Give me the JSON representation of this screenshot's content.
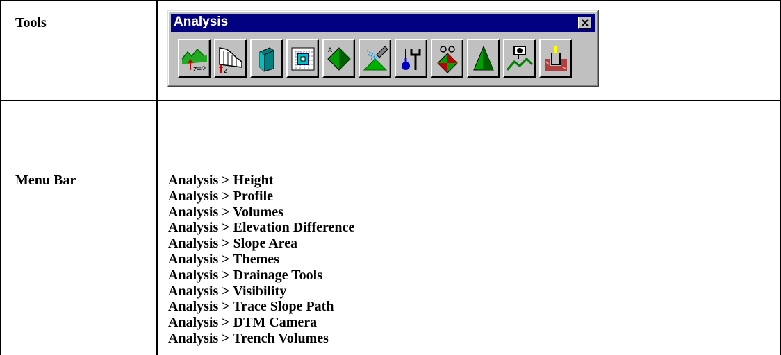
{
  "rows": {
    "tools_label": "Tools",
    "menu_label": "Menu Bar"
  },
  "toolbar": {
    "title": "Analysis",
    "tools": [
      {
        "icon": "height-icon",
        "label": "Height"
      },
      {
        "icon": "profile-icon",
        "label": "Profile"
      },
      {
        "icon": "volumes-icon",
        "label": "Volumes"
      },
      {
        "icon": "elevation-difference-icon",
        "label": "Elevation Difference"
      },
      {
        "icon": "slope-area-icon",
        "label": "Slope Area"
      },
      {
        "icon": "themes-icon",
        "label": "Themes"
      },
      {
        "icon": "drainage-tools-icon",
        "label": "Drainage Tools"
      },
      {
        "icon": "visibility-icon",
        "label": "Visibility"
      },
      {
        "icon": "trace-slope-path-icon",
        "label": "Trace Slope Path"
      },
      {
        "icon": "dtm-camera-icon",
        "label": "DTM Camera"
      },
      {
        "icon": "trench-volumes-icon",
        "label": "Trench Volumes"
      }
    ]
  },
  "menu_items": [
    "Analysis > Height",
    "Analysis > Profile",
    "Analysis > Volumes",
    "Analysis > Elevation Difference",
    "Analysis > Slope Area",
    "Analysis > Themes",
    "Analysis > Drainage Tools",
    "Analysis > Visibility",
    "Analysis > Trace Slope Path",
    "Analysis > DTM Camera",
    "Analysis > Trench Volumes"
  ],
  "colors": {
    "titlebar": "#000080",
    "window_face": "#c0c0c0"
  }
}
